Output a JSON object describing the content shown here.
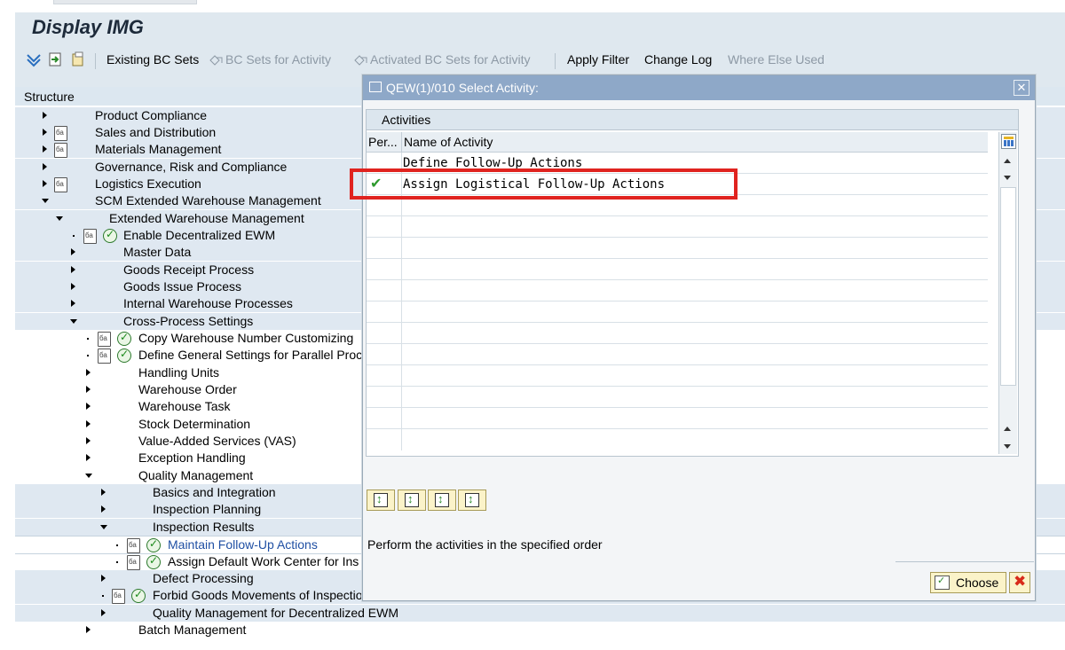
{
  "window": {
    "title": "Display IMG"
  },
  "toolbar": {
    "existing_bc_sets": "Existing BC Sets",
    "bc_sets_for_activity": "BC Sets for Activity",
    "activated_bc_sets": "Activated BC Sets for Activity",
    "apply_filter": "Apply Filter",
    "change_log": "Change Log",
    "where_else_used": "Where Else Used"
  },
  "structure": {
    "header": "Structure",
    "rows": [
      "Product Compliance",
      "Sales and Distribution",
      "Materials Management",
      "Governance, Risk and Compliance",
      "Logistics Execution",
      "SCM Extended Warehouse Management",
      "Extended Warehouse Management",
      "Enable Decentralized EWM",
      "Master Data",
      "Goods Receipt Process",
      "Goods Issue Process",
      "Internal Warehouse Processes",
      "Cross-Process Settings",
      "Copy Warehouse Number Customizing",
      "Define General Settings for Parallel Proce",
      "Handling Units",
      "Warehouse Order",
      "Warehouse Task",
      "Stock Determination",
      "Value-Added Services (VAS)",
      "Exception Handling",
      "Quality Management",
      "Basics and Integration",
      "Inspection Planning",
      "Inspection Results",
      "Maintain Follow-Up Actions",
      "Assign Default Work Center for Ins",
      "Defect Processing",
      "Forbid Goods Movements of Inspection Docum",
      "Quality Management for Decentralized EWM",
      "Batch Management"
    ]
  },
  "dialog": {
    "title": "QEW(1)/010 Select Activity:",
    "group_label": "Activities",
    "col_performed": "Per...",
    "col_name": "Name of Activity",
    "activities": [
      {
        "name": "Define Follow-Up Actions",
        "done": false
      },
      {
        "name": "Assign Logistical Follow-Up Actions",
        "done": true
      }
    ],
    "hint": "Perform the activities in the specified order",
    "choose_label": "Choose"
  }
}
